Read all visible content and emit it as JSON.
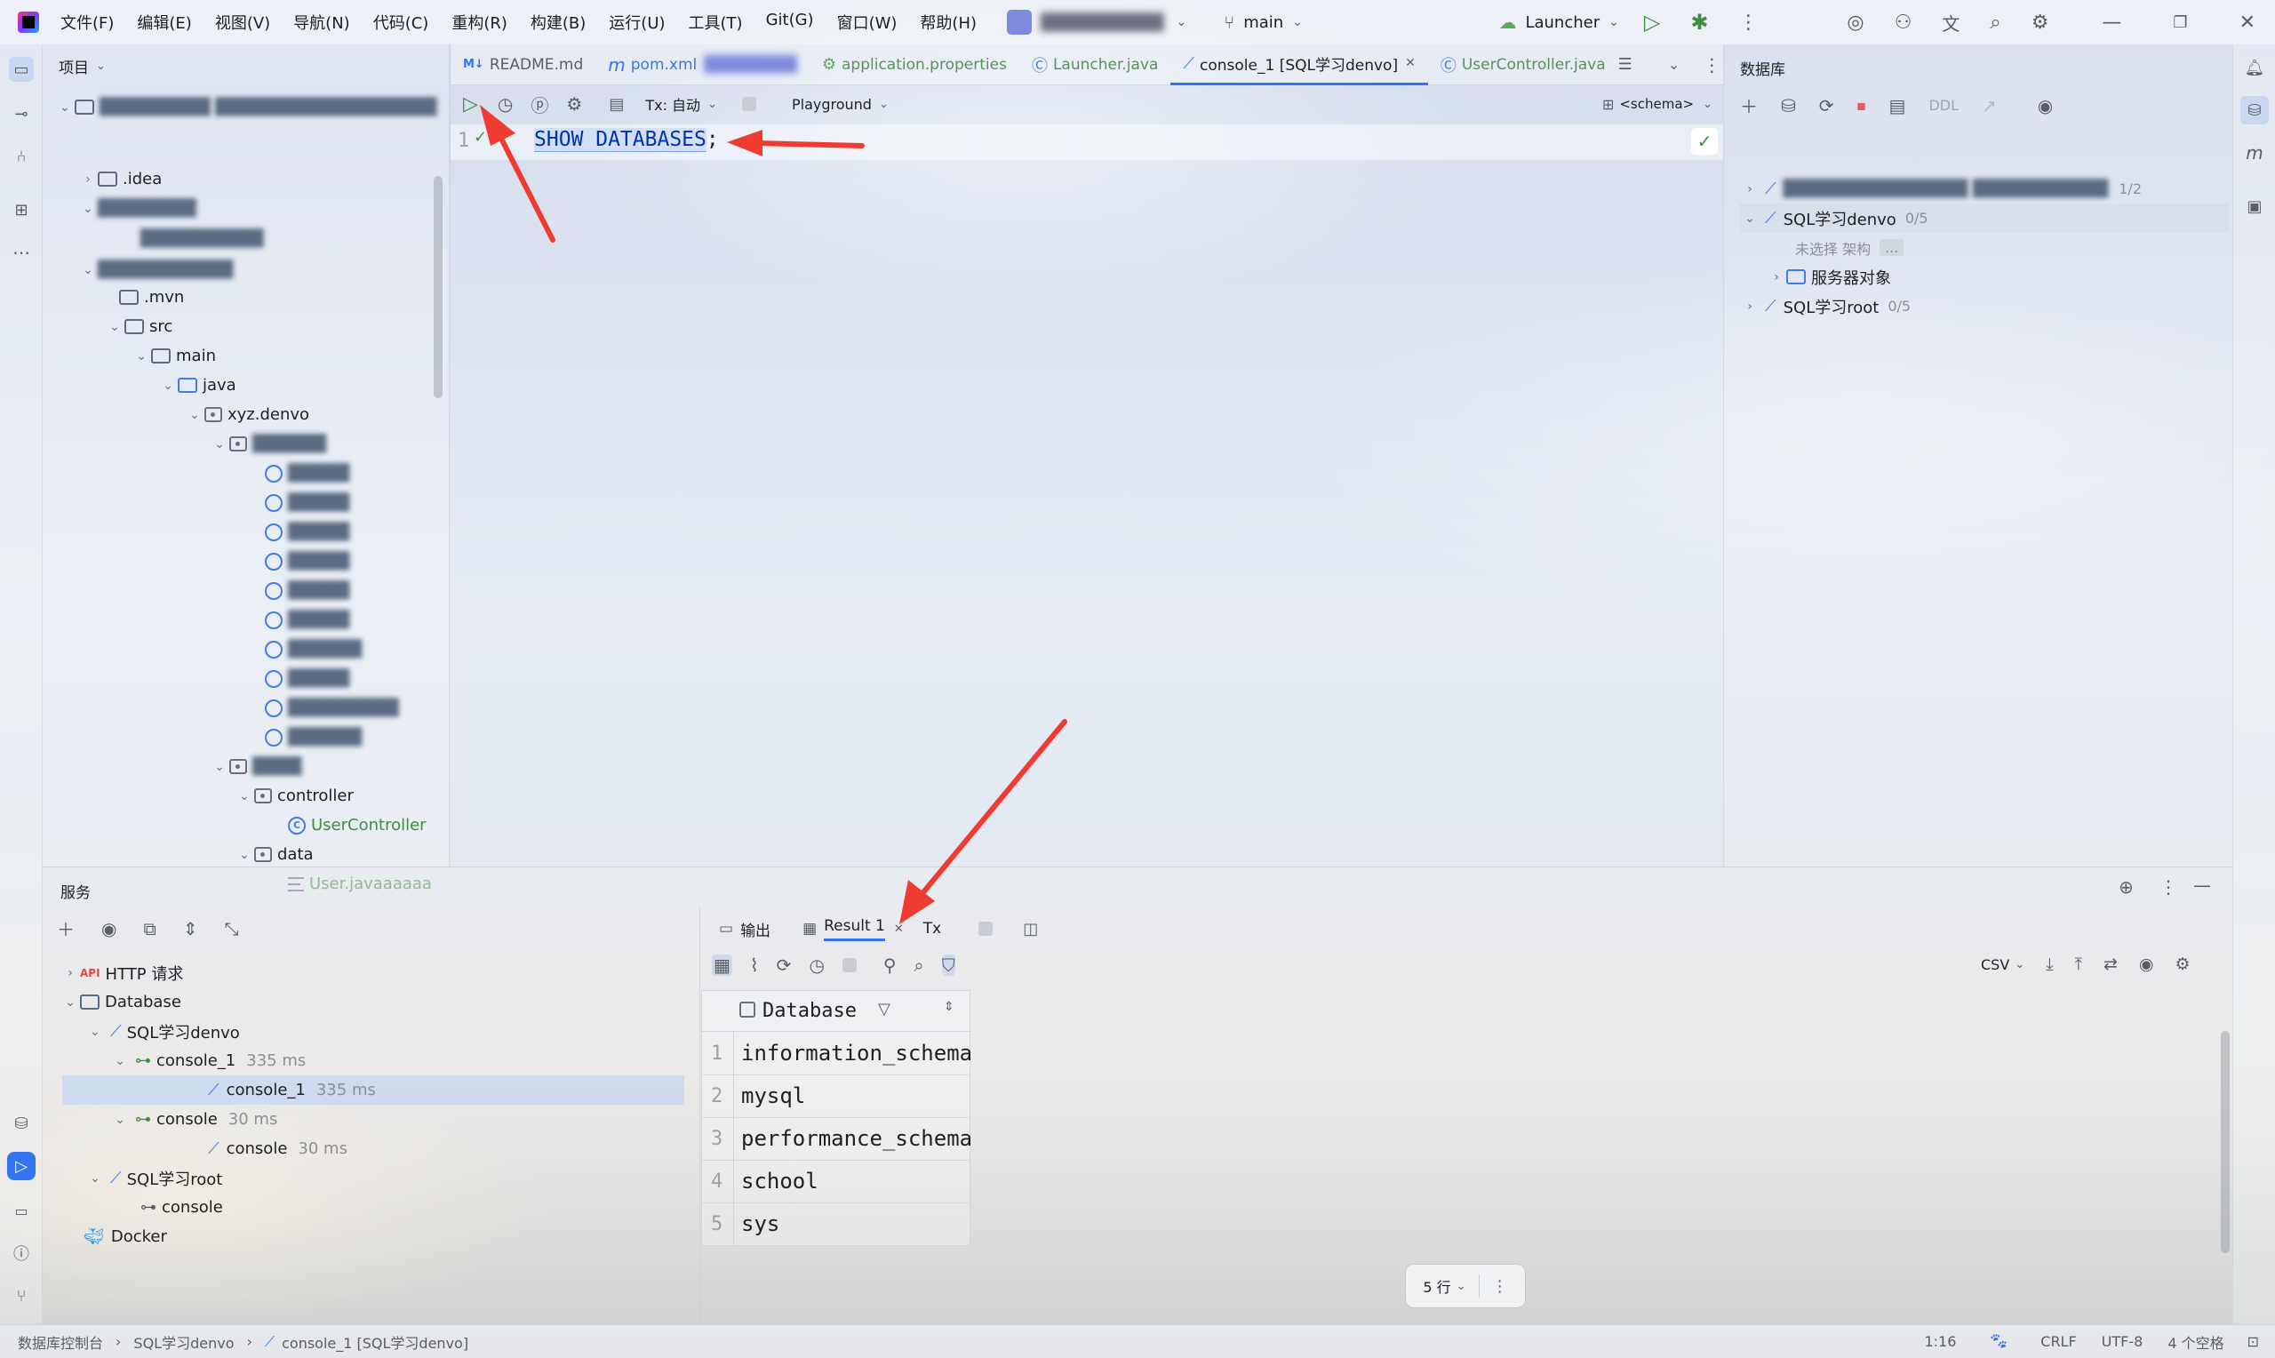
{
  "menu": {
    "items": [
      "文件(F)",
      "编辑(E)",
      "视图(V)",
      "导航(N)",
      "代码(C)",
      "重构(R)",
      "构建(B)",
      "运行(U)",
      "工具(T)",
      "Git(G)",
      "窗口(W)",
      "帮助(H)"
    ],
    "branch": "main",
    "run_config": "Launcher"
  },
  "project": {
    "title": "项目",
    "items": {
      "idea": ".idea",
      "mvn": ".mvn",
      "src": "src",
      "main": "main",
      "java": "java",
      "xyz": "xyz.denvo",
      "controller": "controller",
      "usercontroller": "UserController",
      "data": "data",
      "userjava": "User.javaaaaaa"
    }
  },
  "tabs": [
    {
      "label": "README.md"
    },
    {
      "label": "pom.xml"
    },
    {
      "label": "application.properties"
    },
    {
      "label": "Launcher.java"
    },
    {
      "label": "console_1 [SQL学习denvo]"
    },
    {
      "label": "UserController.java"
    }
  ],
  "editor": {
    "tx_label": "Tx: 自动",
    "playground": "Playground",
    "schema": "<schema>",
    "line_no": "1",
    "code_keyword": "SHOW DATABASES",
    "code_semicolon": ";"
  },
  "database": {
    "title": "数据库",
    "ddl": "DDL",
    "ds1_count": "1/2",
    "ds2_name": "SQL学习denvo",
    "ds2_count": "0/5",
    "no_schema": "未选择 架构",
    "ellipsis": "...",
    "server_objects": "服务器对象",
    "ds3_name": "SQL学习root",
    "ds3_count": "0/5"
  },
  "services": {
    "title": "服务",
    "http": "HTTP 请求",
    "database": "Database",
    "denvo": "SQL学习denvo",
    "console1_group": "console_1",
    "console1_group_time": "335 ms",
    "console1_item": "console_1",
    "console1_item_time": "335 ms",
    "console_group": "console",
    "console_group_time": "30 ms",
    "console_item": "console",
    "console_item_time": "30 ms",
    "root": "SQL学习root",
    "root_console": "console",
    "docker": "Docker"
  },
  "results": {
    "tab_output": "输出",
    "tab_result": "Result 1",
    "tab_tx": "Tx",
    "column": "Database",
    "rows": [
      "information_schema",
      "mysql",
      "performance_schema",
      "school",
      "sys"
    ],
    "row_numbers": [
      "1",
      "2",
      "3",
      "4",
      "5"
    ],
    "export_format": "CSV",
    "row_count": "5 行"
  },
  "statusbar": {
    "crumb1": "数据库控制台",
    "crumb2": "SQL学习denvo",
    "crumb3": "console_1 [SQL学习denvo]",
    "position": "1:16",
    "line_sep": "CRLF",
    "encoding": "UTF-8",
    "indent": "4 个空格"
  },
  "colors": {
    "accent": "#3574f0",
    "run_green": "#3e8e41",
    "arrow_red": "#ef3b32"
  }
}
